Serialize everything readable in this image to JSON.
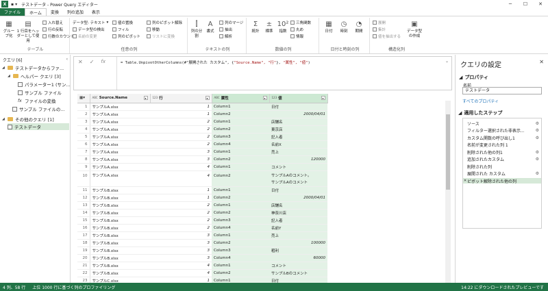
{
  "window": {
    "title": "テストデータ - Power Query エディター",
    "app_icon": "X"
  },
  "tabs": [
    "ファイル",
    "ホーム",
    "変換",
    "列の追加",
    "表示"
  ],
  "ribbon": {
    "group_table": {
      "label": "テーブル",
      "grouping": "グループ化",
      "first_row": "1 行目をヘッダーとして使用",
      "transpose": "入れ替え",
      "reverse": "行の反転",
      "count": "行数のカウント"
    },
    "group_any": {
      "label": "任意の列",
      "datatype": "データ型: テキスト",
      "detect": "データ型の検出",
      "rename": "名前の変更",
      "replace": "値の置換",
      "fill": "フィル",
      "pivot": "列のピボット",
      "unpivot": "列のピボット解除",
      "move": "移動",
      "list": "リストに変換"
    },
    "group_text": {
      "label": "テキストの列",
      "split": "列の分割",
      "format": "書式",
      "merge": "列のマージ",
      "extract": "抽出",
      "parse": "解析"
    },
    "group_number": {
      "label": "数値の列",
      "stats": "統計",
      "standard": "標準",
      "scientific": "指数",
      "trig": "三角関数",
      "round": "丸め",
      "info": "情報"
    },
    "group_date": {
      "label": "日付と時刻の列",
      "date": "日付",
      "time": "時刻",
      "duration": "期間"
    },
    "group_struct": {
      "label": "構造化列",
      "expand": "展開",
      "aggregate": "集計",
      "extract_values": "値を抽出する",
      "create_type": "データ型の作成"
    }
  },
  "queries": {
    "header": "クエリ [6]",
    "items": [
      {
        "label": "テストデータからファ...",
        "kind": "folder"
      },
      {
        "label": "ヘルパー クエリ [3]",
        "kind": "folder"
      },
      {
        "label": "パラメーター1 (サン...",
        "kind": "query"
      },
      {
        "label": "サンプル ファイル",
        "kind": "query"
      },
      {
        "label": "ファイルの変換",
        "kind": "fx"
      },
      {
        "label": "サンプル ファイルの...",
        "kind": "query"
      },
      {
        "label": "その他のクエリ [1]",
        "kind": "folder"
      },
      {
        "label": "テストデータ",
        "kind": "query"
      }
    ]
  },
  "formula": {
    "prefix": "= Table.UnpivotOtherColumns(#\"展開された カスタム\", {",
    "arg1": "\"Source.Name\", \"行\"",
    "mid": "}, ",
    "arg2": "\"属性\", \"値\"",
    "suffix": ")",
    "fx": "fx"
  },
  "columns": [
    {
      "name": "Source.Name",
      "type": "ABC"
    },
    {
      "name": "行",
      "type": "123"
    },
    {
      "name": "属性",
      "type": "ABC"
    },
    {
      "name": "値",
      "type": "123"
    }
  ],
  "rows": [
    [
      "1",
      "サンプルA.xlsx",
      "1",
      "Column1",
      "日付"
    ],
    [
      "2",
      "サンプルA.xlsx",
      "1",
      "Column2",
      "2000/04/01"
    ],
    [
      "3",
      "サンプルA.xlsx",
      "2",
      "Column1",
      "店舗名"
    ],
    [
      "4",
      "サンプルA.xlsx",
      "2",
      "Column2",
      "東京店"
    ],
    [
      "5",
      "サンプルA.xlsx",
      "2",
      "Column3",
      "記入者"
    ],
    [
      "6",
      "サンプルA.xlsx",
      "2",
      "Column4",
      "名前X"
    ],
    [
      "7",
      "サンプルA.xlsx",
      "3",
      "Column1",
      "売上"
    ],
    [
      "8",
      "サンプルA.xlsx",
      "3",
      "Column2",
      "120000"
    ],
    [
      "9",
      "サンプルA.xlsx",
      "4",
      "Column1",
      "コメント"
    ],
    [
      "10",
      "サンプルA.xlsx",
      "4",
      "Column2",
      "サンプルAのコメント。\nサンプルAのコメント"
    ],
    [
      "11",
      "サンプルB.xlsx",
      "1",
      "Column1",
      "日付"
    ],
    [
      "12",
      "サンプルB.xlsx",
      "1",
      "Column2",
      "2000/04/01"
    ],
    [
      "13",
      "サンプルB.xlsx",
      "2",
      "Column1",
      "店舗名"
    ],
    [
      "14",
      "サンプルB.xlsx",
      "2",
      "Column2",
      "神奈川店"
    ],
    [
      "15",
      "サンプルB.xlsx",
      "2",
      "Column3",
      "記入者"
    ],
    [
      "16",
      "サンプルB.xlsx",
      "2",
      "Column4",
      "名前Y"
    ],
    [
      "17",
      "サンプルB.xlsx",
      "3",
      "Column1",
      "売上"
    ],
    [
      "18",
      "サンプルB.xlsx",
      "3",
      "Column2",
      "100000"
    ],
    [
      "19",
      "サンプルB.xlsx",
      "3",
      "Column3",
      "粗利"
    ],
    [
      "20",
      "サンプルB.xlsx",
      "3",
      "Column4",
      "60000"
    ],
    [
      "21",
      "サンプルB.xlsx",
      "4",
      "Column1",
      "コメント"
    ],
    [
      "22",
      "サンプルB.xlsx",
      "4",
      "Column2",
      "サンプルBのコメント"
    ],
    [
      "23",
      "サンプルC.xlsx",
      "1",
      "Column1",
      "日付"
    ]
  ],
  "settings": {
    "title": "クエリの設定",
    "properties": "プロパティ",
    "name_label": "名前",
    "name_value": "テストデータ",
    "all_props": "すべてのプロパティ",
    "steps_title": "適用したステップ",
    "steps": [
      {
        "label": "ソース",
        "gear": true
      },
      {
        "label": "フィルター選択された非表示...",
        "gear": true
      },
      {
        "label": "カスタム関数の呼び出し1",
        "gear": true
      },
      {
        "label": "名前が変更された列 1",
        "gear": false
      },
      {
        "label": "削除された他の列1",
        "gear": true
      },
      {
        "label": "追加されたカスタム",
        "gear": true
      },
      {
        "label": "削除された列",
        "gear": false
      },
      {
        "label": "展開された カスタム",
        "gear": true
      },
      {
        "label": "ピボット解除された他の列",
        "gear": false
      }
    ]
  },
  "status": {
    "cols": "4 列、58 行",
    "profiling": "上位 1000 行に基づく列のプロファイリング",
    "preview": "14:22 にダウンロードされたプレビューです"
  }
}
